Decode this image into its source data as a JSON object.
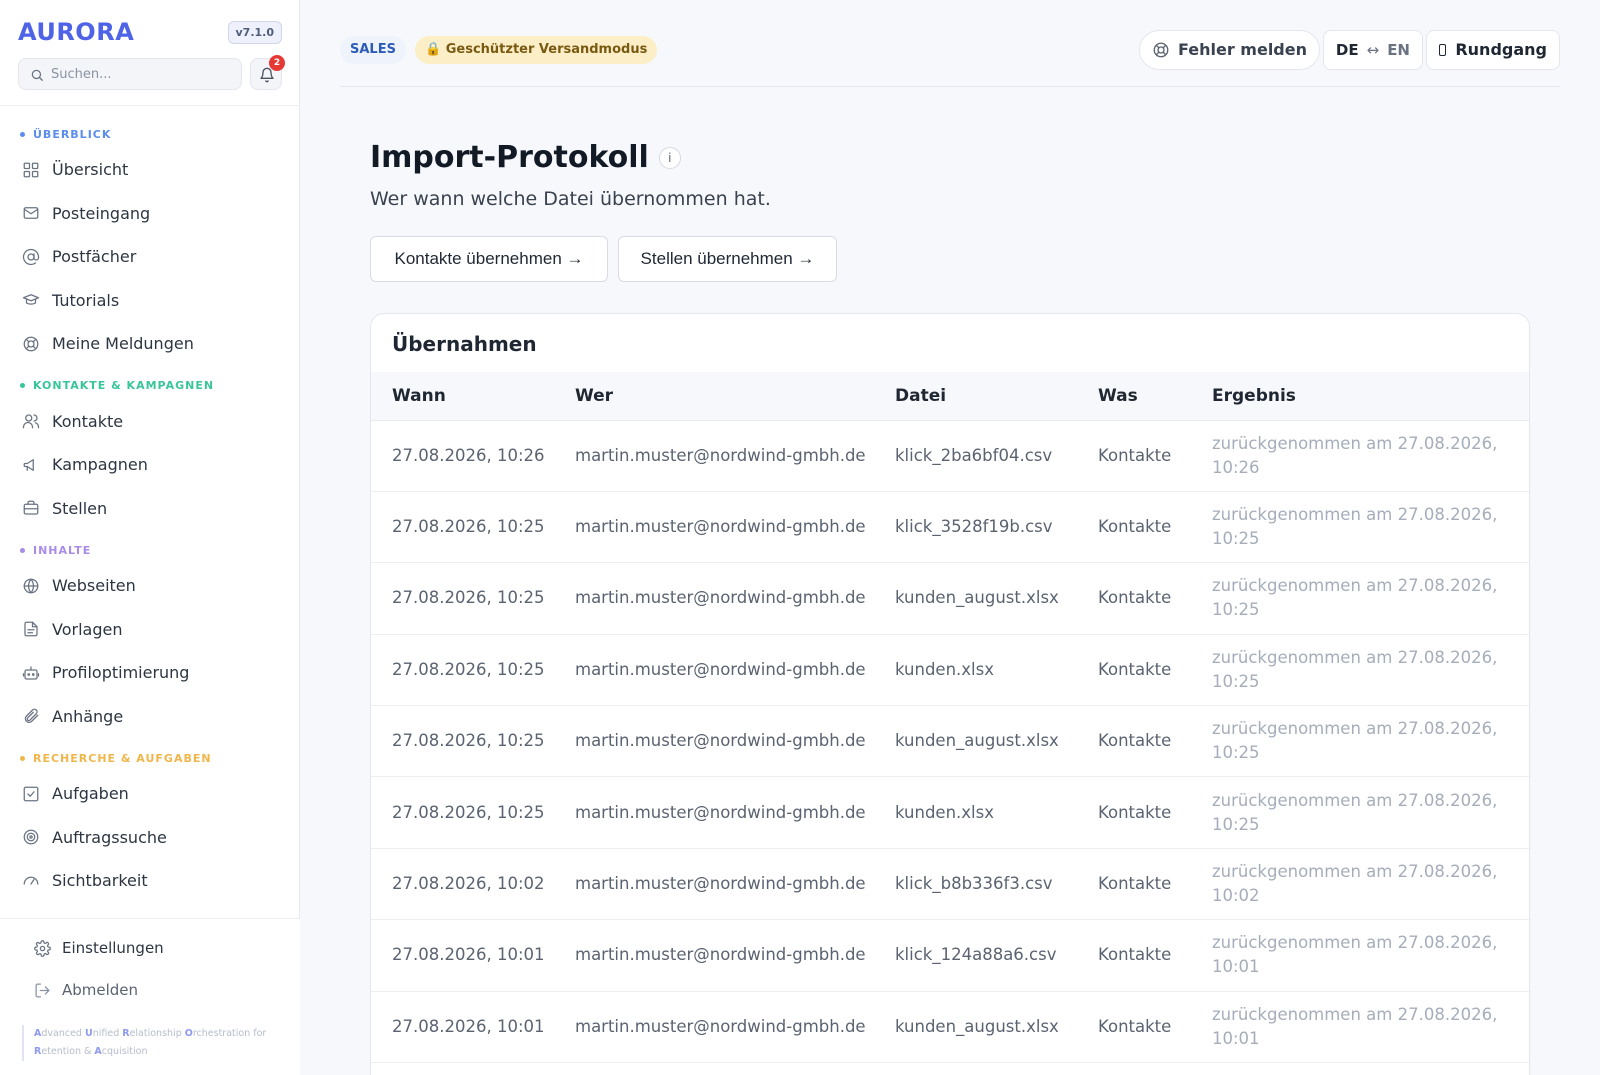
{
  "sidebar": {
    "brand": "AURORA",
    "version": "v7.1.0",
    "search_placeholder": "Suchen...",
    "notification_count": "2",
    "sections": [
      {
        "title": "ÜBERBLICK",
        "color": "#5b8def",
        "items": [
          {
            "label": "Übersicht",
            "icon": "dashboard-icon"
          },
          {
            "label": "Posteingang",
            "icon": "mail-icon"
          },
          {
            "label": "Postfächer",
            "icon": "at-icon"
          },
          {
            "label": "Tutorials",
            "icon": "graduation-cap-icon"
          },
          {
            "label": "Meine Meldungen",
            "icon": "lifebuoy-icon"
          }
        ]
      },
      {
        "title": "KONTAKTE & KAMPAGNEN",
        "color": "#38c59a",
        "items": [
          {
            "label": "Kontakte",
            "icon": "users-icon"
          },
          {
            "label": "Kampagnen",
            "icon": "megaphone-icon"
          },
          {
            "label": "Stellen",
            "icon": "briefcase-icon"
          }
        ]
      },
      {
        "title": "INHALTE",
        "color": "#a98bea",
        "items": [
          {
            "label": "Webseiten",
            "icon": "globe-icon"
          },
          {
            "label": "Vorlagen",
            "icon": "document-icon"
          },
          {
            "label": "Profiloptimierung",
            "icon": "robot-icon"
          },
          {
            "label": "Anhänge",
            "icon": "paperclip-icon"
          }
        ]
      },
      {
        "title": "RECHERCHE & AUFGABEN",
        "color": "#f0b64a",
        "items": [
          {
            "label": "Aufgaben",
            "icon": "checkbox-icon"
          },
          {
            "label": "Auftragssuche",
            "icon": "target-icon"
          },
          {
            "label": "Sichtbarkeit",
            "icon": "gauge-icon"
          }
        ]
      }
    ],
    "bottom": {
      "settings": "Einstellungen",
      "logout": "Abmelden"
    },
    "acronym": [
      {
        "letter": "A",
        "rest": "dvanced "
      },
      {
        "letter": "U",
        "rest": "nified "
      },
      {
        "letter": "R",
        "rest": "elationship "
      },
      {
        "letter": "O",
        "rest": "rchestration for "
      },
      {
        "letter": "R",
        "rest": "etention & "
      },
      {
        "letter": "A",
        "rest": "cquisition"
      }
    ]
  },
  "topbar": {
    "mode_pill": "SALES",
    "safe_mode_pill": "Geschützter Versandmodus",
    "report_bug": "Fehler melden",
    "lang_from": "DE",
    "lang_arrow": "↔",
    "lang_to": "EN",
    "tour": "Rundgang"
  },
  "main": {
    "title": "Import-Protokoll",
    "info": "i",
    "subtitle": "Wer wann welche Datei übernommen hat.",
    "btn_contacts": "Kontakte übernehmen →",
    "btn_jobs": "Stellen übernehmen →",
    "card_title": "Übernahmen",
    "columns": [
      "Wann",
      "Wer",
      "Datei",
      "Was",
      "Ergebnis"
    ],
    "rows": [
      {
        "wann": "27.08.2026, 10:26",
        "wer": "martin.muster@nordwind-gmbh.de",
        "datei": "klick_2ba6bf04.csv",
        "was": "Kontakte",
        "ergebnis": "zurückgenommen am 27.08.2026, 10:26"
      },
      {
        "wann": "27.08.2026, 10:25",
        "wer": "martin.muster@nordwind-gmbh.de",
        "datei": "klick_3528f19b.csv",
        "was": "Kontakte",
        "ergebnis": "zurückgenommen am 27.08.2026, 10:25"
      },
      {
        "wann": "27.08.2026, 10:25",
        "wer": "martin.muster@nordwind-gmbh.de",
        "datei": "kunden_august.xlsx",
        "was": "Kontakte",
        "ergebnis": "zurückgenommen am 27.08.2026, 10:25"
      },
      {
        "wann": "27.08.2026, 10:25",
        "wer": "martin.muster@nordwind-gmbh.de",
        "datei": "kunden.xlsx",
        "was": "Kontakte",
        "ergebnis": "zurückgenommen am 27.08.2026, 10:25"
      },
      {
        "wann": "27.08.2026, 10:25",
        "wer": "martin.muster@nordwind-gmbh.de",
        "datei": "kunden_august.xlsx",
        "was": "Kontakte",
        "ergebnis": "zurückgenommen am 27.08.2026, 10:25"
      },
      {
        "wann": "27.08.2026, 10:25",
        "wer": "martin.muster@nordwind-gmbh.de",
        "datei": "kunden.xlsx",
        "was": "Kontakte",
        "ergebnis": "zurückgenommen am 27.08.2026, 10:25"
      },
      {
        "wann": "27.08.2026, 10:02",
        "wer": "martin.muster@nordwind-gmbh.de",
        "datei": "klick_b8b336f3.csv",
        "was": "Kontakte",
        "ergebnis": "zurückgenommen am 27.08.2026, 10:02"
      },
      {
        "wann": "27.08.2026, 10:01",
        "wer": "martin.muster@nordwind-gmbh.de",
        "datei": "klick_124a88a6.csv",
        "was": "Kontakte",
        "ergebnis": "zurückgenommen am 27.08.2026, 10:01"
      },
      {
        "wann": "27.08.2026, 10:01",
        "wer": "martin.muster@nordwind-gmbh.de",
        "datei": "kunden_august.xlsx",
        "was": "Kontakte",
        "ergebnis": "zurückgenommen am 27.08.2026, 10:01"
      }
    ]
  }
}
